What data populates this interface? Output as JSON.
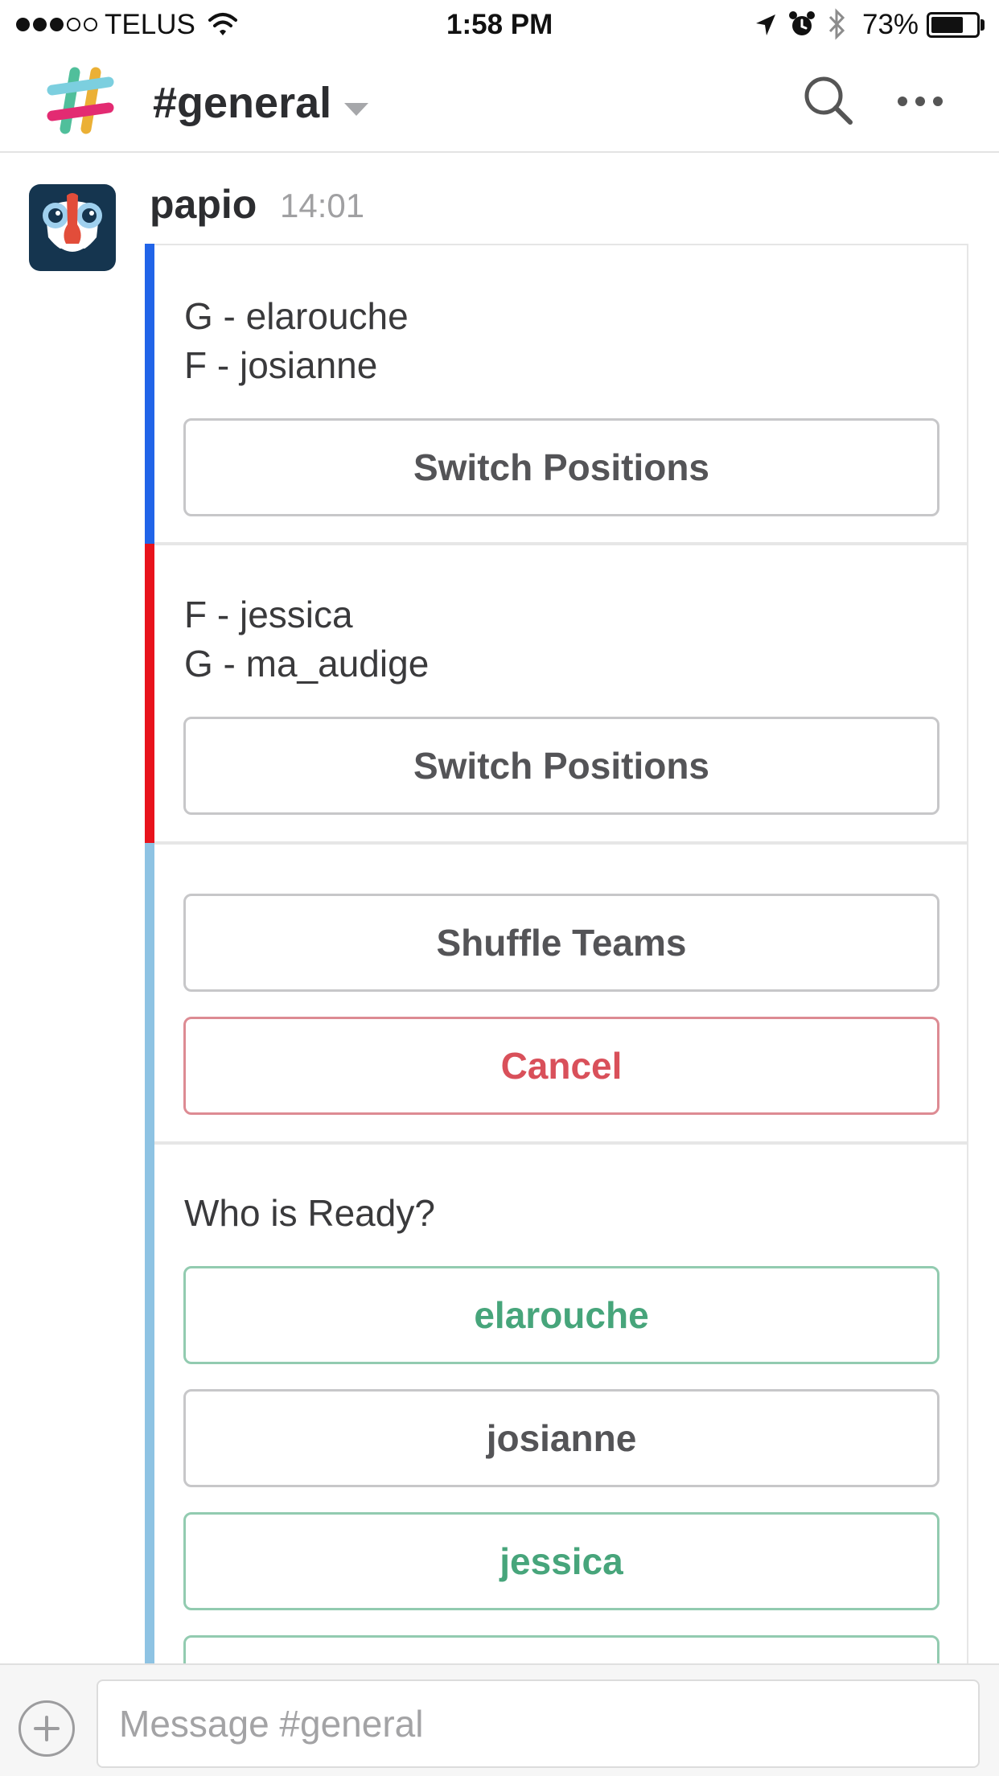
{
  "status_bar": {
    "carrier": "TELUS",
    "time": "1:58 PM",
    "battery": "73%",
    "battery_level": 0.73,
    "signal_bars": 3,
    "signal_max": 5
  },
  "header": {
    "channel": "#general"
  },
  "message": {
    "author": "papio",
    "time": "14:01"
  },
  "attachments": [
    {
      "color": "#2164e8",
      "lines": [
        "G - elarouche",
        "F - josianne"
      ],
      "button": "Switch Positions"
    },
    {
      "color": "#e8131c",
      "lines": [
        "F - jessica",
        "G - ma_audige"
      ],
      "button": "Switch Positions"
    },
    {
      "color": "#8ec3e3",
      "shuffle_button": "Shuffle Teams",
      "cancel_button": "Cancel"
    },
    {
      "color": "#8ec3e3",
      "title": "Who is Ready?",
      "players": [
        {
          "name": "elarouche",
          "ready": true
        },
        {
          "name": "josianne",
          "ready": false
        },
        {
          "name": "jessica",
          "ready": true
        }
      ]
    }
  ],
  "colors": {
    "ready": "#47a57b",
    "danger": "#d9505a",
    "default_button": "#545457"
  },
  "composer": {
    "placeholder": "Message #general"
  }
}
